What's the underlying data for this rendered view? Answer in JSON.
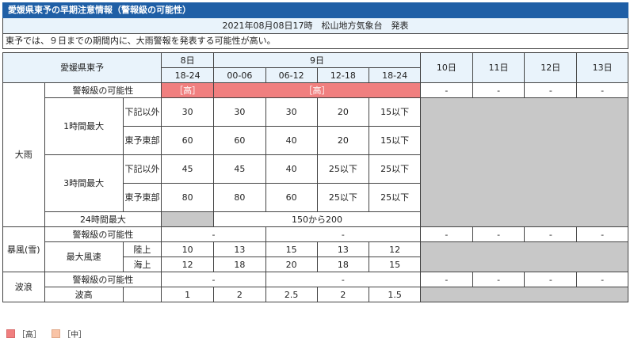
{
  "title": "愛媛県東予の早期注意情報（警報級の可能性）",
  "issued": "2021年08月08日17時　松山地方気象台　発表",
  "summary": "東予では、９日までの期間内に、大雨警報を発表する可能性が高い。",
  "header": {
    "area": "愛媛県東予",
    "day8": "8日",
    "day9": "9日",
    "day10": "10日",
    "day11": "11日",
    "day12": "12日",
    "day13": "13日",
    "t1": "18-24",
    "t2": "00-06",
    "t3": "06-12",
    "t4": "12-18",
    "t5": "18-24"
  },
  "rain": {
    "label": "大雨",
    "possibility_label": "警報級の可能性",
    "high_a": "［高］",
    "high_b": "［高］",
    "dash": "-",
    "h1_label": "1時間最大",
    "h3_label": "3時間最大",
    "sub_other": "下記以外",
    "sub_east": "東予東部",
    "h1_other": [
      "30",
      "30",
      "30",
      "20",
      "15以下"
    ],
    "h1_east": [
      "60",
      "60",
      "40",
      "20",
      "15以下"
    ],
    "h3_other": [
      "45",
      "45",
      "40",
      "25以下",
      "25以下"
    ],
    "h3_east": [
      "80",
      "80",
      "60",
      "25以下",
      "25以下"
    ],
    "h24_label": "24時間最大",
    "h24_value": "150から200"
  },
  "wind": {
    "label": "暴風(雪)",
    "possibility_label": "警報級の可能性",
    "p_a": "-",
    "p_b": "-",
    "max_label": "最大風速",
    "land_label": "陸上",
    "sea_label": "海上",
    "land": [
      "10",
      "13",
      "15",
      "13",
      "12"
    ],
    "sea": [
      "12",
      "18",
      "20",
      "18",
      "15"
    ]
  },
  "wave": {
    "label": "波浪",
    "possibility_label": "警報級の可能性",
    "p_a": "-",
    "p_b": "-",
    "height_label": "波高",
    "height": [
      "1",
      "2",
      "2.5",
      "2",
      "1.5"
    ]
  },
  "legend": {
    "high": "［高］",
    "mid": "［中］"
  },
  "colors": {
    "title_bg": "#1f5fa6",
    "header_bg": "#e9f3fb",
    "high": "#f07f7f",
    "mid": "#f9c4a7",
    "nodata": "#c8c8c8"
  }
}
